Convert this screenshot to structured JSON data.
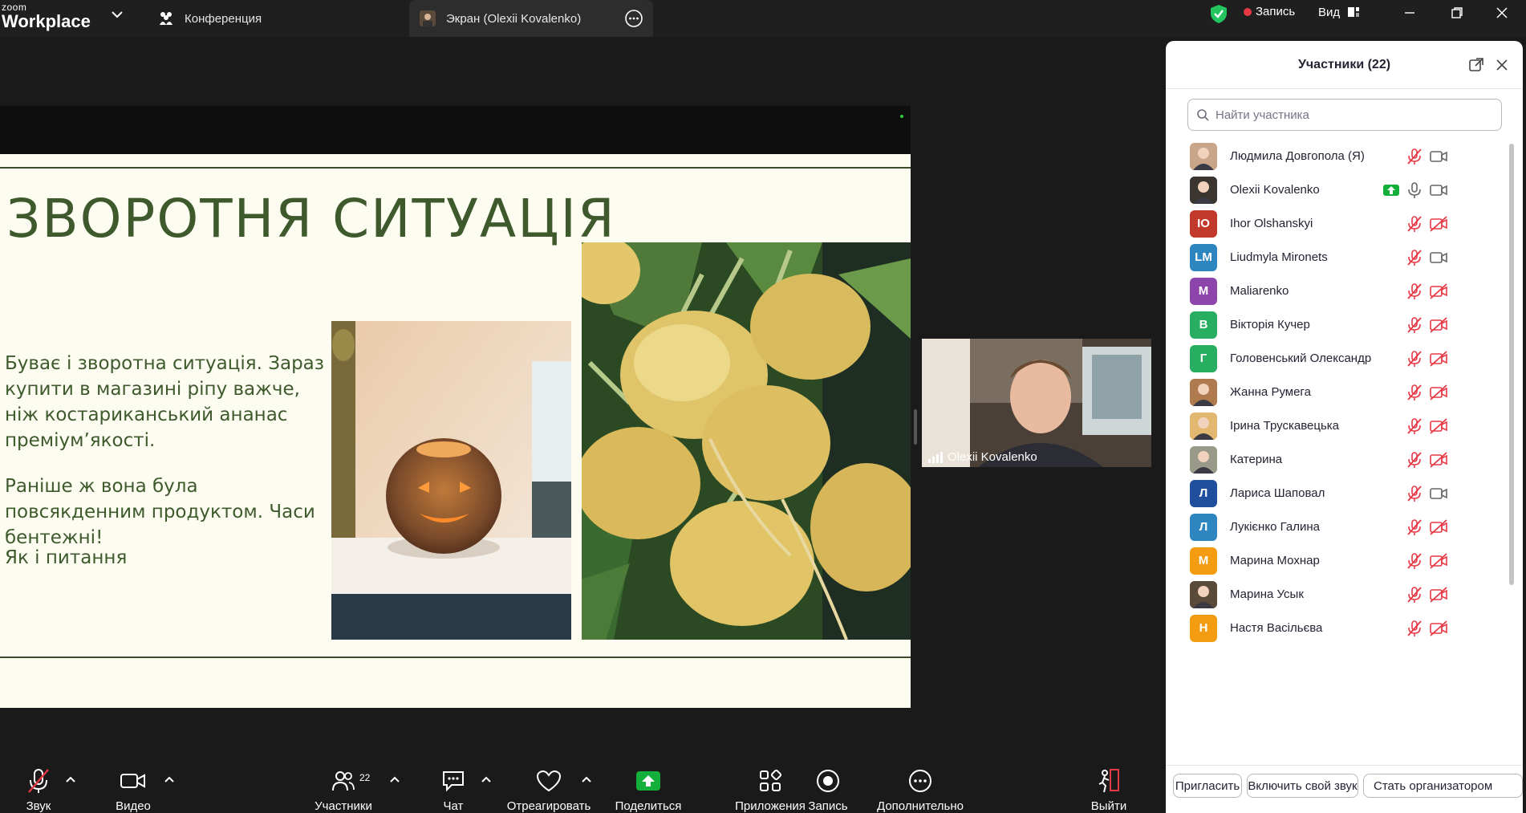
{
  "app": {
    "brand_small": "zoom",
    "brand_name": "Workplace"
  },
  "tabs": [
    {
      "label": "Конференция"
    },
    {
      "label": "Экран (Olexii  Kovalenko)"
    }
  ],
  "top_right": {
    "record_label": "Запись",
    "view_label": "Вид"
  },
  "slide": {
    "title": "ЗВОРОТНЯ СИТУАЦІЯ",
    "paragraph1": "Буває і зворотна ситуація. Зараз купити в магазині ріпу важче, ніж костариканський ананас преміум’якості.",
    "paragraph2": "Раніше ж вона була повсякденним продуктом. Часи бентежні!",
    "paragraph3": "Як і питання"
  },
  "video_tile": {
    "name": "Olexii  Kovalenko"
  },
  "panel": {
    "title": "Участники (22)",
    "search_placeholder": "Найти участника",
    "participants": [
      {
        "name": "Людмила Довгопола (Я)",
        "initials": "",
        "color": "#c9a58a",
        "mic": "muted",
        "cam": "on",
        "photo": true
      },
      {
        "name": "Olexii  Kovalenko",
        "initials": "",
        "color": "#3b3530",
        "mic": "on",
        "cam": "on",
        "photo": true,
        "sharing": true
      },
      {
        "name": "Ihor Olshanskyi",
        "initials": "IO",
        "color": "#c0392b",
        "mic": "muted",
        "cam": "off"
      },
      {
        "name": "Liudmyla Mironets",
        "initials": "LM",
        "color": "#2e86c1",
        "mic": "muted",
        "cam": "on"
      },
      {
        "name": "Maliarenko",
        "initials": "M",
        "color": "#8e44ad",
        "mic": "muted",
        "cam": "off"
      },
      {
        "name": "Вікторія Кучер",
        "initials": "B",
        "color": "#27ae60",
        "mic": "muted",
        "cam": "off"
      },
      {
        "name": "Головенський Олександр",
        "initials": "Г",
        "color": "#27ae60",
        "mic": "muted",
        "cam": "off"
      },
      {
        "name": "Жанна Румега",
        "initials": "",
        "color": "#b07a4f",
        "mic": "muted",
        "cam": "off",
        "photo": true
      },
      {
        "name": "Ірина Трускавецька",
        "initials": "",
        "color": "#e2b770",
        "mic": "muted",
        "cam": "off",
        "photo": true
      },
      {
        "name": "Катерина",
        "initials": "",
        "color": "#9a9a8a",
        "mic": "muted",
        "cam": "off",
        "photo": true
      },
      {
        "name": "Лариса Шаповал",
        "initials": "Л",
        "color": "#1f4e9c",
        "mic": "muted",
        "cam": "on"
      },
      {
        "name": "Лукієнко Галина",
        "initials": "Л",
        "color": "#2e86c1",
        "mic": "muted",
        "cam": "off"
      },
      {
        "name": "Марина Мохнар",
        "initials": "M",
        "color": "#f39c12",
        "mic": "muted",
        "cam": "off"
      },
      {
        "name": "Марина Усык",
        "initials": "",
        "color": "#5a4a3a",
        "mic": "muted",
        "cam": "off",
        "photo": true
      },
      {
        "name": "Настя Васільєва",
        "initials": "H",
        "color": "#f39c12",
        "mic": "muted",
        "cam": "off"
      }
    ],
    "buttons": {
      "invite": "Пригласить",
      "unmute_self": "Включить свой звук",
      "make_host": "Стать организатором"
    }
  },
  "toolbar": {
    "audio": "Звук",
    "video": "Видео",
    "participants": "Участники",
    "participants_count": "22",
    "chat": "Чат",
    "react": "Отреагировать",
    "share": "Поделиться",
    "apps": "Приложения",
    "record": "Запись",
    "more": "Дополнительно",
    "leave": "Выйти"
  },
  "colors": {
    "accent_red": "#e63946",
    "share_green": "#12b03a",
    "slide_text": "#3e5a2d"
  }
}
